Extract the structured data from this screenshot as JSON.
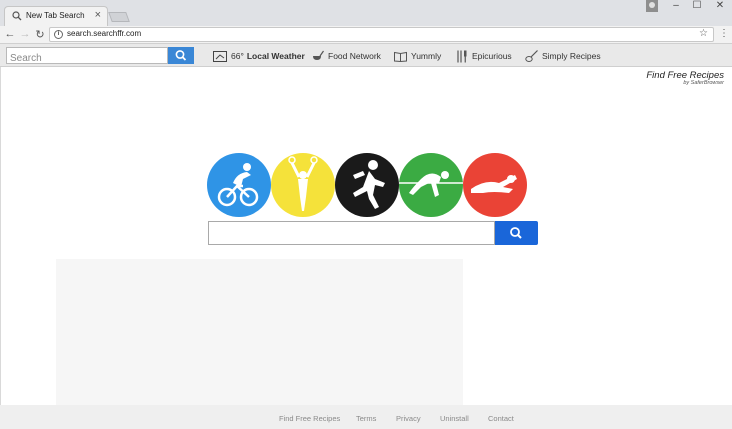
{
  "browser": {
    "tab_title": "New Tab Search",
    "tab_close": "×",
    "url": "search.searchffr.com",
    "window_controls": [
      "–",
      "☐",
      "✕"
    ]
  },
  "extension_bar": {
    "search_placeholder": "Search",
    "weather_temp": "66°",
    "weather_label": "Local Weather",
    "links": [
      "Food Network",
      "Yummly",
      "Epicurious",
      "Simply Recipes"
    ]
  },
  "brand": {
    "name": "Find Free Recipes",
    "sub": "by SaferBrowser"
  },
  "sports_circles": [
    {
      "icon": "cyclist-icon",
      "color": "#2f94e6"
    },
    {
      "icon": "gymnast-icon",
      "color": "#f5e23a"
    },
    {
      "icon": "runner-icon",
      "color": "#1a1a1a"
    },
    {
      "icon": "high-jumper-icon",
      "color": "#3bab43"
    },
    {
      "icon": "swimmer-icon",
      "color": "#ea4336"
    }
  ],
  "main_search": {
    "value": ""
  },
  "footer": {
    "links": [
      "Find Free Recipes",
      "Terms",
      "Privacy",
      "Uninstall",
      "Contact"
    ]
  },
  "colors": {
    "accent_blue": "#1a66d9",
    "ext_search_blue": "#3a87d6"
  }
}
